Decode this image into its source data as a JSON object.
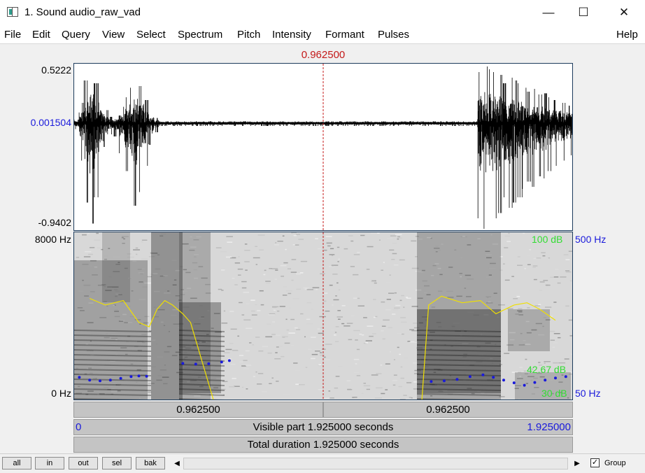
{
  "window": {
    "title": "1. Sound audio_raw_vad",
    "minimize": "—",
    "maximize": "☐",
    "close": "✕"
  },
  "menu": [
    "File",
    "Edit",
    "Query",
    "View",
    "Select",
    "Spectrum",
    "Pitch",
    "Intensity",
    "Formant",
    "Pulses"
  ],
  "help": "Help",
  "cursor": {
    "time_label": "0.962500",
    "time": 0.9625
  },
  "waveform": {
    "ymax": "0.5222",
    "ymid": "0.001504",
    "ymin": "-0.9402"
  },
  "spectrogram": {
    "freq_top": "8000 Hz",
    "freq_bottom": "0 Hz",
    "intensity_top": "100 dB",
    "intensity_current": "42.67 dB",
    "intensity_bottom": "30 dB",
    "pitch_top": "500 Hz",
    "pitch_bottom": "50 Hz"
  },
  "selection_bar": {
    "left": "0.962500",
    "right": "0.962500"
  },
  "visible_bar": {
    "start": "0",
    "label": "Visible part 1.925000 seconds",
    "end": "1.925000"
  },
  "total_bar": {
    "label": "Total duration 1.925000 seconds"
  },
  "toolbar": {
    "all": "all",
    "in": "in",
    "out": "out",
    "sel": "sel",
    "bak": "bak",
    "scroll_left": "◀",
    "scroll_right": "▶",
    "group_label": "Group",
    "group_checked": "✓"
  },
  "colors": {
    "cursor": "#c41a1a",
    "intensity": "#f0e000",
    "pitch": "#1a1adb",
    "panel_border": "#1c3b5c"
  },
  "chart_data": [
    {
      "type": "line",
      "series": [
        {
          "values": [
            0.05,
            0.35,
            0.75,
            0.95,
            0.7,
            0.4,
            0.22,
            0.1,
            0.12,
            0.28,
            0.45,
            0.62,
            0.78,
            0.65,
            0.4,
            0.2,
            0.08,
            0.02,
            0.02,
            0.02,
            0.02,
            0.02,
            0.02,
            0.02,
            0.02,
            0.02,
            0.02,
            0.02,
            0.02,
            0.02,
            0.02,
            0.02,
            0.02,
            0.02,
            0.02,
            0.02,
            0.02,
            0.02,
            0.02,
            0.02,
            0.02,
            0.02,
            0.02,
            0.02,
            0.02,
            0.02,
            0.02,
            0.02,
            0.02,
            0.02,
            0.02,
            0.02,
            0.02,
            0.02,
            0.02,
            0.02,
            0.02,
            0.02,
            0.02,
            0.02,
            0.02,
            0.02,
            0.02,
            0.02,
            0.02,
            0.02,
            0.02,
            0.02,
            0.02,
            0.02,
            0.02,
            0.02,
            0.02,
            0.02,
            0.02,
            0.02,
            0.02,
            0.02,
            0.02,
            0.02,
            0.02,
            0.9,
            1.0,
            0.95,
            0.9,
            0.85,
            0.7,
            0.8,
            0.75,
            0.7,
            0.62,
            0.55,
            0.6,
            0.5,
            0.52,
            0.45,
            0.4,
            0.4,
            0.35,
            0.3
          ]
        }
      ],
      "ylim": [
        -0.9402,
        0.5222
      ]
    },
    {
      "type": "line",
      "series": [
        {
          "color": "#f0e000",
          "x": [
            0.06,
            0.12,
            0.19,
            0.25,
            0.29,
            0.32,
            0.35,
            0.38,
            0.42,
            0.45,
            0.5,
            0.55,
            0.6,
            0.8,
            0.9,
            1.0,
            1.1,
            1.2,
            1.28,
            1.32,
            1.34,
            1.37,
            1.42,
            1.5,
            1.57,
            1.63,
            1.7,
            1.75,
            1.8,
            1.86
          ],
          "y": [
            73,
            70,
            72,
            62,
            60,
            68,
            72,
            70,
            66,
            62,
            42,
            22,
            19,
            17,
            17,
            17,
            17,
            17,
            17,
            17,
            20,
            70,
            74,
            71,
            72,
            66,
            70,
            71,
            68,
            63
          ]
        },
        {
          "color": "#1a1adb",
          "x": [
            0.02,
            0.06,
            0.1,
            0.14,
            0.18,
            0.22,
            0.25,
            0.28,
            0.42,
            0.47,
            0.52,
            0.57,
            0.6,
            1.38,
            1.43,
            1.48,
            1.53,
            1.58,
            1.62,
            1.66,
            1.7,
            1.74,
            1.78,
            1.82,
            1.86,
            1.9
          ],
          "y": [
            98,
            90,
            88,
            90,
            95,
            100,
            102,
            101,
            138,
            136,
            137,
            142,
            146,
            86,
            88,
            92,
            100,
            105,
            98,
            90,
            82,
            75,
            83,
            90,
            96,
            100
          ]
        }
      ],
      "ylim": [
        30,
        100
      ]
    }
  ]
}
